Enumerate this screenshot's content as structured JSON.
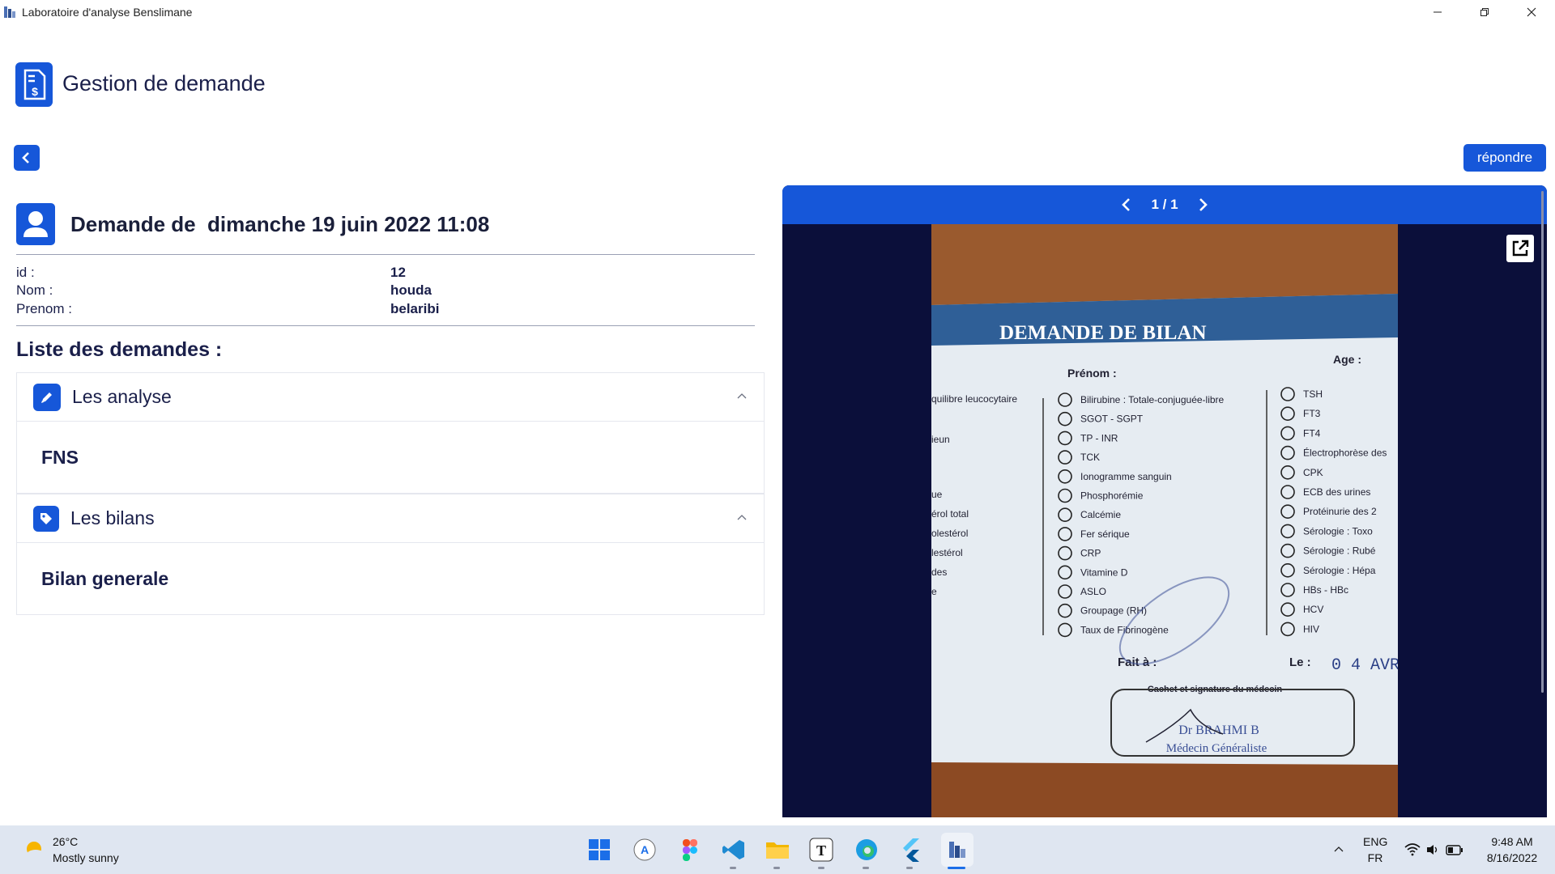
{
  "window": {
    "title": "Laboratoire d'analyse Benslimane"
  },
  "header": {
    "title": "Gestion de demande"
  },
  "actions": {
    "reply_label": "répondre"
  },
  "demande": {
    "title": "Demande de  dimanche 19 juin 2022 11:08",
    "fields": [
      {
        "label": "id :",
        "value": "12"
      },
      {
        "label": "Nom :",
        "value": "houda"
      },
      {
        "label": "Prenom :",
        "value": "belaribi"
      }
    ]
  },
  "list": {
    "title": "Liste des demandes :",
    "sections": [
      {
        "title": "Les analyse",
        "items": [
          "FNS"
        ]
      },
      {
        "title": "Les bilans",
        "items": [
          "Bilan generale"
        ]
      }
    ]
  },
  "viewer": {
    "page_indicator": "1 / 1",
    "photo": {
      "heading": "DEMANDE DE BILAN",
      "age_label": "Age :",
      "prenom_label": "Prénom :",
      "left_column": [
        "quilibre leucocytaire",
        "ieun",
        "ue",
        "érol total",
        "olestérol",
        "lestérol",
        "des",
        "e"
      ],
      "middle_column": [
        "Bilirubine : Totale-conjuguée-libre",
        "SGOT - SGPT",
        "TP - INR",
        "TCK",
        "Ionogramme sanguin",
        "Phosphorémie",
        "Calcémie",
        "Fer sérique",
        "CRP",
        "Vitamine D",
        "ASLO",
        "Groupage (RH)",
        "Taux de Fibrinogène"
      ],
      "right_column": [
        "TSH",
        "FT3",
        "FT4",
        "Électrophorèse des",
        "CPK",
        "ECB des urines",
        "Protéinurie des 2",
        "Sérologie : Toxo",
        "Sérologie : Rubé",
        "Sérologie : Hépa",
        "HBs - HBc",
        "HCV",
        "HIV"
      ],
      "fait_label": "Fait à :",
      "le_label": "Le :",
      "le_value": "0 4 AVR",
      "cachet_label": "Cachet et signature du médecin",
      "stamp_name": "Dr BRAHMI B",
      "stamp_title": "Médecin Généraliste"
    }
  },
  "taskbar": {
    "weather_temp": "26°C",
    "weather_desc": "Mostly sunny",
    "lang_top": "ENG",
    "lang_bottom": "FR",
    "time": "9:48 AM",
    "date": "8/16/2022"
  }
}
